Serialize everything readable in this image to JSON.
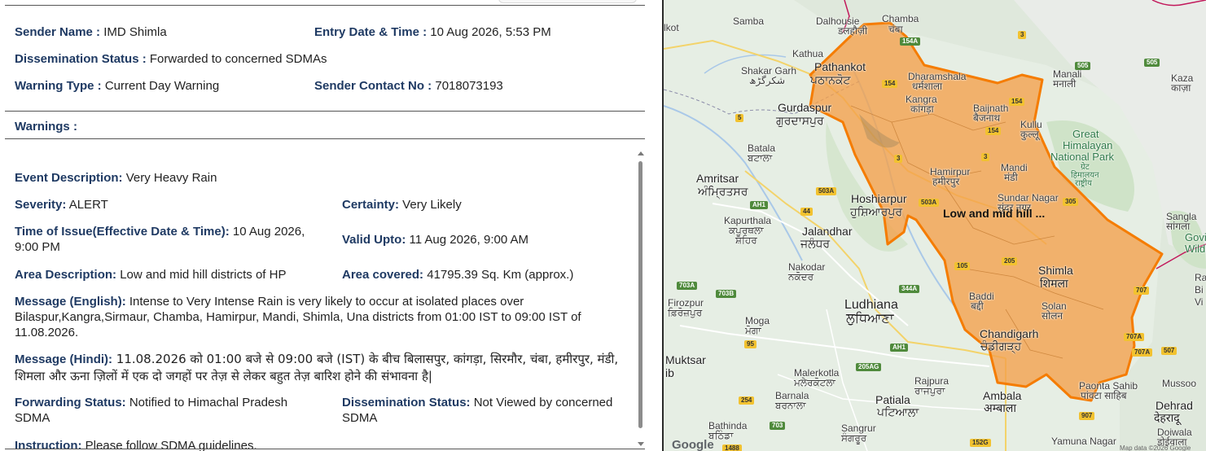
{
  "header": {
    "sender_name_label": "Sender Name :",
    "sender_name": " IMD Shimla",
    "entry_label": "Entry Date & Time :",
    "entry_value": " 10 Aug 2026, 5:53 PM",
    "dissemination_label": "Dissemination Status :",
    "dissemination_value": " Forwarded to concerned SDMAs",
    "warning_type_label": "Warning Type :",
    "warning_type_value": " Current Day Warning",
    "contact_label": "Sender Contact No :",
    "contact_value": " 7018073193"
  },
  "warnings": {
    "heading": "Warnings :",
    "event_label": "Event Description:",
    "event_value": " Very Heavy Rain",
    "severity_label": "Severity:",
    "severity_value": " ALERT",
    "certainty_label": "Certainty:",
    "certainty_value": " Very Likely",
    "issue_label": "Time of Issue(Effective Date & Time):",
    "issue_value": " 10 Aug 2026, 9:00 PM",
    "valid_label": "Valid Upto:",
    "valid_value": " 11 Aug 2026, 9:00 AM",
    "area_desc_label": "Area Description:",
    "area_desc_value": " Low and mid hill districts of HP",
    "area_cov_label": "Area covered:",
    "area_cov_value": " 41795.39 Sq. Km (approx.)",
    "msg_en_label": "Message (English):",
    "msg_en_value": " Intense to Very Intense Rain is very likely to occur at isolated places over Bilaspur,Kangra,Sirmaur, Chamba, Hamirpur, Mandi, Shimla, Una districts from 01:00 IST to 09:00 IST of 11.08.2026.",
    "msg_hi_label": "Message (Hindi):",
    "msg_hi_value": " 11.08.2026 को 01:00 बजे से 09:00 बजे (IST) के बीच बिलासपुर, कांगड़ा, सिरमौर, चंबा, हमीरपुर, मंडी, शिमला और ऊना ज़िलों में एक दो जगहों पर तेज़ से लेकर बहुत तेज़ बारिश होने की संभावना है|",
    "forwarding_label": "Forwarding Status:",
    "forwarding_value": " Notified to Himachal Pradesh SDMA",
    "diss2_label": "Dissemination Status:",
    "diss2_value": " Not Viewed by concerned SDMA",
    "instruction_label": "Instruction:",
    "instruction_value": " Please follow SDMA guidelines."
  },
  "map": {
    "area_label": "Low and mid hill ...",
    "google": "Google",
    "map_data": "Map data ©2026 Google",
    "colors": {
      "polygon_fill": "#f4a04a",
      "polygon_stroke": "#f57c00"
    },
    "places": {
      "sialkot": "lkot",
      "samba": "Samba",
      "dalhousie": "Dalhousie",
      "dalhousie_hi": "डलहौज़ी",
      "chamba": "Chamba",
      "chamba_hi": "चंबा",
      "kathua": "Kathua",
      "shakargarh": "Shakar Garh",
      "shakargarh_ur": "شکرگڑھ",
      "pathankot": "Pathankot",
      "pathankot_pa": "ਪਠਾਨਕੋਟ",
      "dharamshala": "Dharamshala",
      "dharamshala_hi": "धर्मशाला",
      "kangra": "Kangra",
      "kangra_hi": "कांगड़ा",
      "baijnath": "Baijnath",
      "baijnath_hi": "बैजनाथ",
      "manali": "Manali",
      "manali_hi": "मनाली",
      "kaza": "Kaza",
      "kaza_hi": "काज़ा",
      "gurdaspur": "Gurdaspur",
      "gurdaspur_pa": "ਗੁਰਦਾਸਪੁਰ",
      "kullu": "Kullu",
      "kullu_hi": "कुल्लू",
      "ghnp1": "Great",
      "ghnp2": "Himalayan",
      "ghnp3": "National Park",
      "ghnp_hi1": "ग्रेट",
      "ghnp_hi2": "हिमालयन",
      "ghnp_hi3": "राष्ट्रीय",
      "batala": "Batala",
      "batala_pa": "ਬਟਾਲਾ",
      "hamirpur": "Hamirpur",
      "hamirpur_hi": "हमीरपुर",
      "mandi": "Mandi",
      "mandi_hi": "मंडी",
      "amritsar": "Amritsar",
      "amritsar_pa": "ਅੰਮ੍ਰਿਤਸਰ",
      "hoshiarpur": "Hoshiarpur",
      "hoshiarpur_pa": "ਹੁਸ਼ਿਆਰਪੁਰ",
      "sundarnagar": "Sundar Nagar",
      "sundarnagar_hi": "सुंदर नगर",
      "sangla": "Sangla",
      "sangla_hi": "सांगला",
      "govind1": "Govin",
      "govind2": "Wildl",
      "kapurthala": "Kapurthala",
      "kapurthala_pa1": "ਕਪੂਰਥਲਾ",
      "kapurthala_pa2": "ਸ਼ਹਿਰ",
      "jalandhar": "Jalandhar",
      "jalandhar_pa": "ਜਲੰਧਰ",
      "shimla": "Shimla",
      "shimla_hi": "शिमला",
      "nakodar": "Nakodar",
      "nakodar_pa": "ਨਕੋਦਰ",
      "ludhiana": "Ludhiana",
      "ludhiana_pa": "ਲੁਧਿਆਣਾ",
      "baddi": "Baddi",
      "baddi_hi": "बद्दी",
      "solan": "Solan",
      "solan_hi": "सोलन",
      "firozpur": "Firozpur",
      "firozpur_pa": "ਫ਼ਿਰੋਜ਼ਪੁਰ",
      "moga": "Moga",
      "moga_pa": "ਮੋਗਾ",
      "chandigarh": "Chandigarh",
      "chandigarh_pa": "ਚੰਡੀਗੜ੍ਹ",
      "muktsar": "Muktsar",
      "muktsar_pa": "ib",
      "malerkotla": "Malerkotla",
      "malerkotla_pa": "ਮਲੇਰਕੋਟਲਾ",
      "rajpura": "Rajpura",
      "rajpura_pa": "ਰਾਜਪੁਰਾ",
      "barnala": "Barnala",
      "barnala_pa": "ਬਰਨਾਲਾ",
      "patiala": "Patiala",
      "patiala_pa": "ਪਟਿਆਲਾ",
      "ambala": "Ambala",
      "ambala_hi": "अम्बाला",
      "paonta": "Paonta Sahib",
      "paonta_hi": "पांवटा साहिब",
      "dehradun": "Dehrad",
      "dehradun_hi": "देहरादू",
      "bathinda": "Bathinda",
      "bathinda_pa": "ਬਠਿੰਡਾ",
      "sangrur": "Sangrur",
      "sangrur_pa": "ਸੰਗਰੂਰ",
      "yamuna": "Yamuna Nagar",
      "doiwala": "Doiwala",
      "doiwala_hi": "डोईवाला",
      "mussoorie": "Mussoo",
      "rampur1": "Ra",
      "rampur2": "Bi",
      "rampur3": "Vi"
    },
    "shields": [
      "154A",
      "3",
      "505",
      "154",
      "154",
      "154",
      "3",
      "3",
      "5",
      "305",
      "AH1",
      "503A",
      "44",
      "503A",
      "505",
      "105",
      "205",
      "344A",
      "703A",
      "703B",
      "95",
      "AH1",
      "205AG",
      "254",
      "703",
      "707",
      "707A",
      "707A",
      "507",
      "907",
      "152G",
      "1488"
    ]
  }
}
